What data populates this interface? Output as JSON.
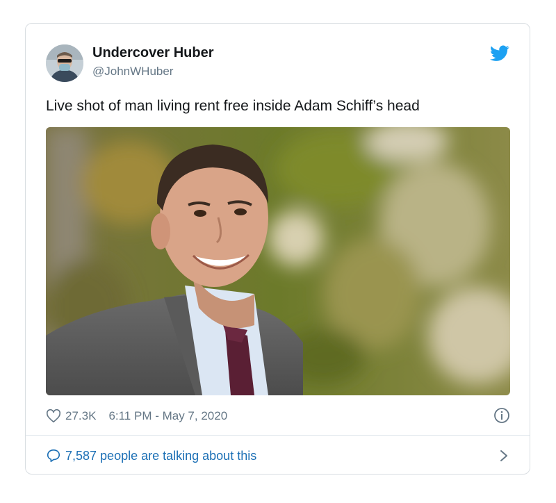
{
  "tweet": {
    "author_name": "Undercover Huber",
    "author_handle": "@JohnWHuber",
    "text": "Live shot of man living rent free inside Adam Schiff’s head",
    "likes": "27.3K",
    "timestamp": "6:11 PM - May 7, 2020",
    "conversation_text": "7,587 people are talking about this"
  },
  "icons": {
    "brand": "twitter-bird-icon",
    "like": "heart-icon",
    "info": "info-icon",
    "reply": "speech-bubble-icon",
    "more": "chevron-right-icon"
  },
  "colors": {
    "twitter_blue": "#1da1f2",
    "link_blue": "#1b6fb5",
    "secondary_text": "#657786",
    "border": "#d9dee2"
  }
}
